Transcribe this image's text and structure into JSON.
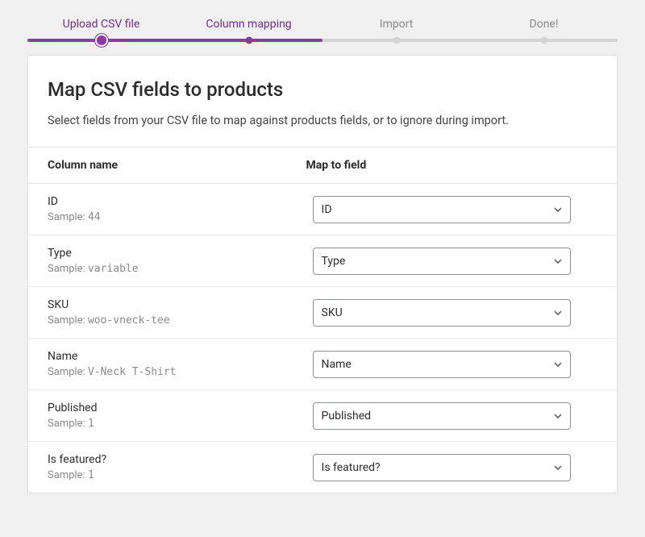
{
  "stepper": {
    "steps": [
      {
        "label": "Upload CSV file",
        "state": "done"
      },
      {
        "label": "Column mapping",
        "state": "current"
      },
      {
        "label": "Import",
        "state": "pending"
      },
      {
        "label": "Done!",
        "state": "pending"
      }
    ]
  },
  "header": {
    "title": "Map CSV fields to products",
    "description": "Select fields from your CSV file to map against products fields, or to ignore during import."
  },
  "table": {
    "column_name_header": "Column name",
    "map_to_field_header": "Map to field",
    "sample_prefix": "Sample:",
    "rows": [
      {
        "name": "ID",
        "sample": "44",
        "selected": "ID"
      },
      {
        "name": "Type",
        "sample": "variable",
        "selected": "Type"
      },
      {
        "name": "SKU",
        "sample": "woo-vneck-tee",
        "selected": "SKU"
      },
      {
        "name": "Name",
        "sample": "V-Neck T-Shirt",
        "selected": "Name"
      },
      {
        "name": "Published",
        "sample": "1",
        "selected": "Published"
      },
      {
        "name": "Is featured?",
        "sample": "1",
        "selected": "Is featured?"
      }
    ]
  }
}
